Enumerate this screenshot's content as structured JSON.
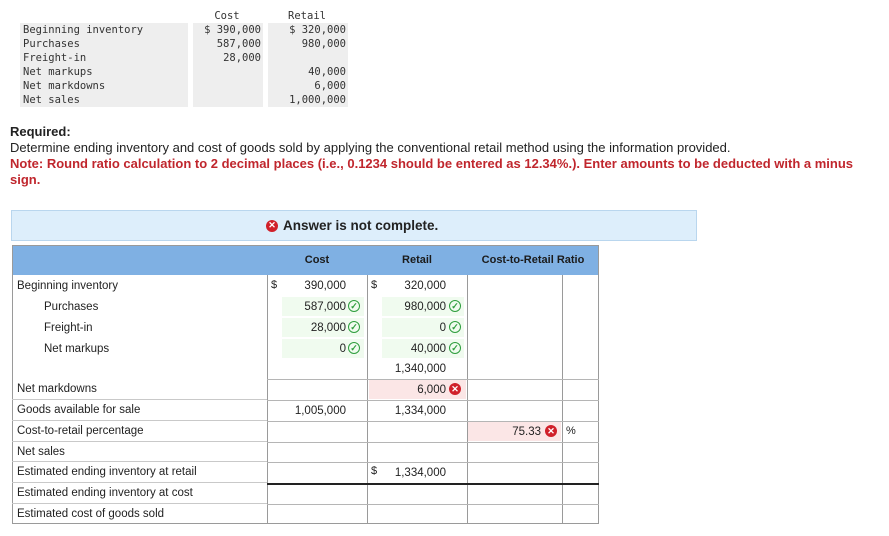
{
  "given": {
    "headers": {
      "cost": "Cost",
      "retail": "Retail"
    },
    "rows": [
      {
        "label": "Beginning inventory",
        "cost": "$ 390,000",
        "retail": "$ 320,000"
      },
      {
        "label": "Purchases",
        "cost": "587,000",
        "retail": "980,000"
      },
      {
        "label": "Freight-in",
        "cost": "28,000",
        "retail": ""
      },
      {
        "label": "Net markups",
        "cost": "",
        "retail": "40,000"
      },
      {
        "label": "Net markdowns",
        "cost": "",
        "retail": "6,000"
      },
      {
        "label": "Net sales",
        "cost": "",
        "retail": "1,000,000"
      }
    ]
  },
  "required": {
    "title": "Required:",
    "text": "Determine ending inventory and cost of goods sold by applying the conventional retail method using the information provided.",
    "note": "Note: Round ratio calculation to 2 decimal places (i.e., 0.1234 should be entered as 12.34%.). Enter amounts to be deducted with a minus sign."
  },
  "banner": {
    "text": "Answer is not complete."
  },
  "answer": {
    "headers": {
      "cost": "Cost",
      "retail": "Retail",
      "ratio": "Cost-to-Retail Ratio"
    },
    "currency": "$",
    "percent": "%",
    "rows": [
      {
        "label": "Beginning inventory",
        "cost": "390,000",
        "retail": "320,000"
      },
      {
        "label": "Purchases",
        "cost": "587,000",
        "retail": "980,000"
      },
      {
        "label": "Freight-in",
        "cost": "28,000",
        "retail": "0"
      },
      {
        "label": "Net markups",
        "cost": "0",
        "retail": "40,000"
      },
      {
        "label": "",
        "cost": "",
        "retail": "1,340,000"
      },
      {
        "label": "Net markdowns",
        "cost": "",
        "retail": "6,000"
      },
      {
        "label": "Goods available for sale",
        "cost": "1,005,000",
        "retail": "1,334,000"
      },
      {
        "label": "Cost-to-retail percentage",
        "ratio": "75.33"
      },
      {
        "label": "Net sales"
      },
      {
        "label": "Estimated ending inventory at retail",
        "retail": "1,334,000"
      },
      {
        "label": "Estimated ending inventory at cost"
      },
      {
        "label": "Estimated cost of goods sold"
      }
    ]
  }
}
